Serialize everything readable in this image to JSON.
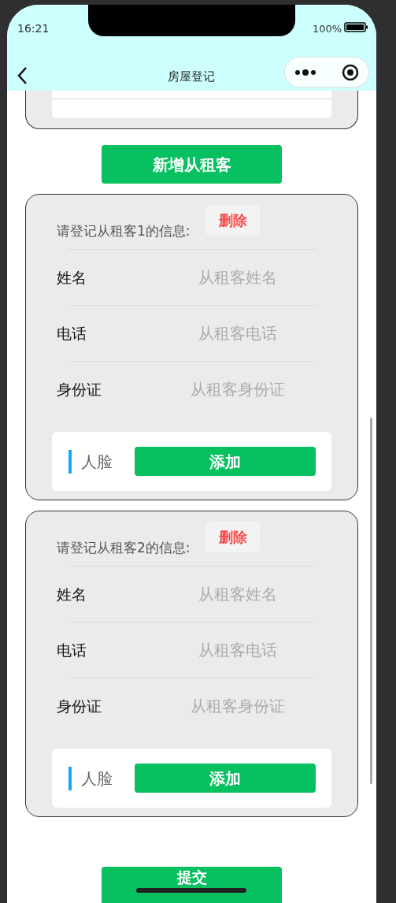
{
  "status_bar": {
    "time": "16:21",
    "battery": "100%"
  },
  "nav": {
    "title": "房屋登记"
  },
  "add_button": "新增从租客",
  "tenants": [
    {
      "heading": "请登记从租客1的信息:",
      "delete": "删除",
      "fields": [
        {
          "label": "姓名",
          "placeholder": "从租客姓名"
        },
        {
          "label": "电话",
          "placeholder": "从租客电话"
        },
        {
          "label": "身份证",
          "placeholder": "从租客身份证"
        }
      ],
      "face": {
        "label": "人脸",
        "button": "添加"
      }
    },
    {
      "heading": "请登记从租客2的信息:",
      "delete": "删除",
      "fields": [
        {
          "label": "姓名",
          "placeholder": "从租客姓名"
        },
        {
          "label": "电话",
          "placeholder": "从租客电话"
        },
        {
          "label": "身份证",
          "placeholder": "从租客身份证"
        }
      ],
      "face": {
        "label": "人脸",
        "button": "添加"
      }
    }
  ],
  "submit": "提交"
}
